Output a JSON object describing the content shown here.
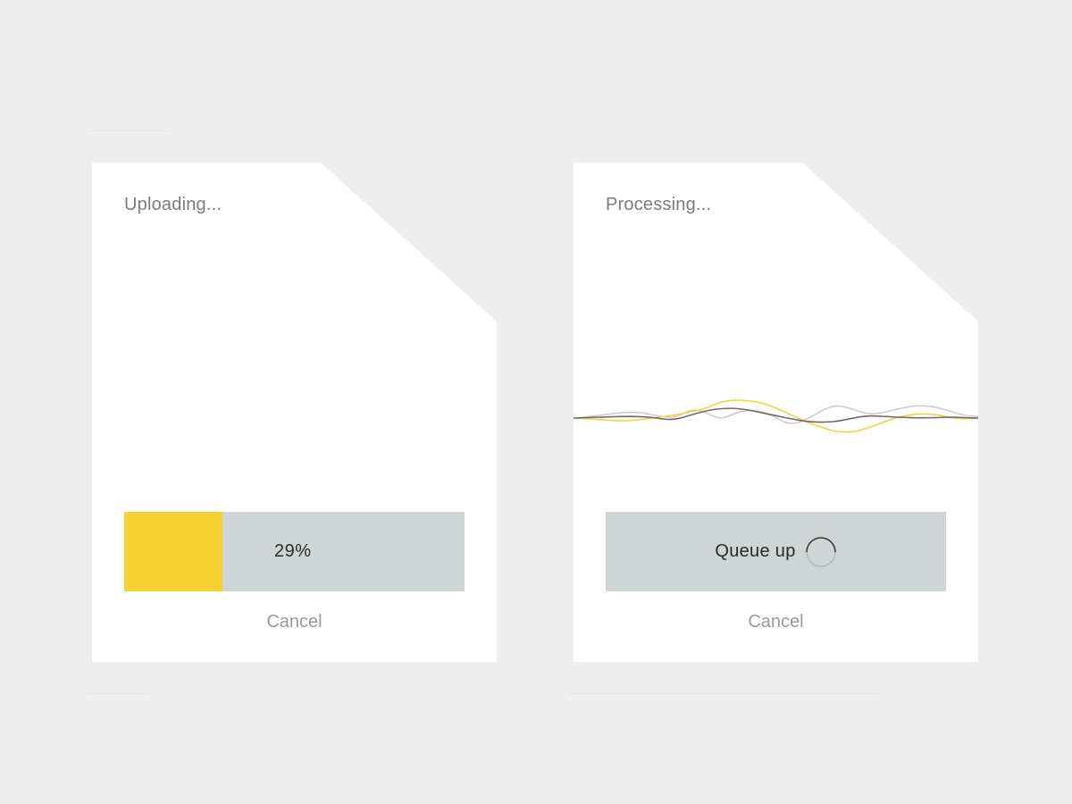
{
  "upload_card": {
    "title": "Uploading...",
    "progress": {
      "percent": 29,
      "label": "29%"
    },
    "cancel_label": "Cancel"
  },
  "processing_card": {
    "title": "Processing...",
    "queue_label": "Queue up",
    "spinner_icon": "loading-spinner-icon",
    "cancel_label": "Cancel"
  },
  "colors": {
    "background": "#eeeeee",
    "card": "#ffffff",
    "accent": "#f5d131",
    "track": "#cfd4d4",
    "wave_dark": "#6b6b6b",
    "wave_light": "#c9c9c9"
  }
}
